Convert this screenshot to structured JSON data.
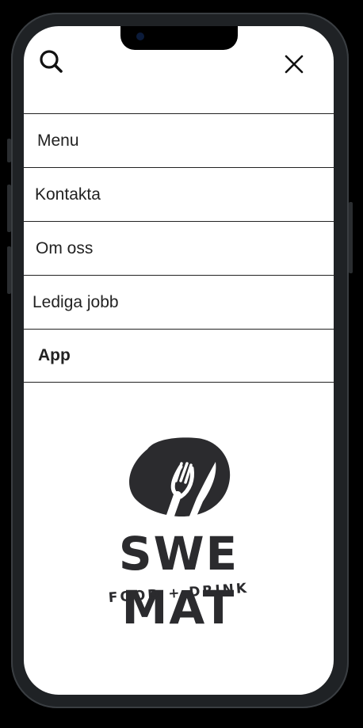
{
  "nav": {
    "items": [
      {
        "label": "Menu"
      },
      {
        "label": "Kontakta"
      },
      {
        "label": "Om oss"
      },
      {
        "label": "Lediga jobb"
      },
      {
        "label": "App"
      }
    ]
  },
  "logo": {
    "name": "SWE MAT",
    "tagline": "FOOD + DRINK"
  },
  "icons": {
    "search": "search-icon",
    "close": "close-icon",
    "logo_mark": "fork-knife-icon"
  },
  "colors": {
    "text": "#222222",
    "logo": "#2b2b2e",
    "background": "#ffffff"
  }
}
